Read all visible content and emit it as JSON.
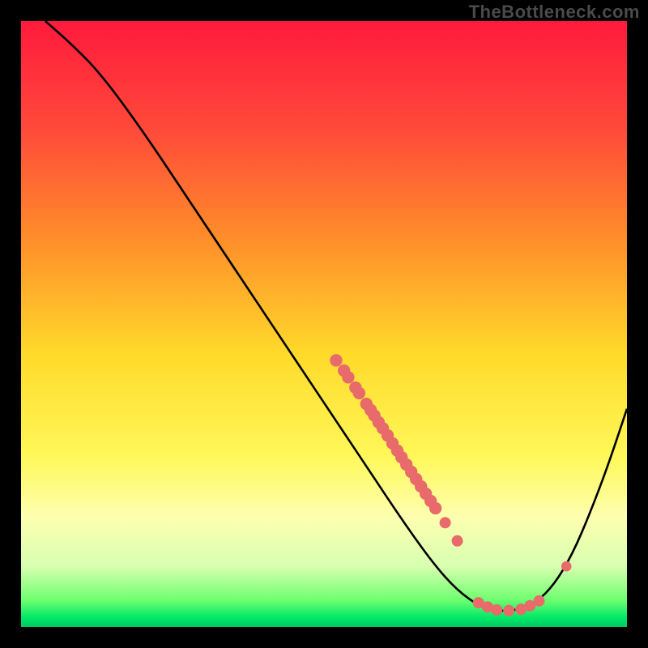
{
  "watermark": "TheBottleneck.com",
  "chart_data": {
    "type": "line",
    "title": "",
    "xlabel": "",
    "ylabel": "",
    "xlim": [
      0,
      100
    ],
    "ylim": [
      0,
      100
    ],
    "background_gradient": {
      "stops": [
        {
          "offset": 0.0,
          "color": "#ff1a3c"
        },
        {
          "offset": 0.18,
          "color": "#ff4a3a"
        },
        {
          "offset": 0.35,
          "color": "#ff8a2a"
        },
        {
          "offset": 0.55,
          "color": "#ffda2a"
        },
        {
          "offset": 0.72,
          "color": "#fff85a"
        },
        {
          "offset": 0.82,
          "color": "#fdffb0"
        },
        {
          "offset": 0.9,
          "color": "#d8ffb0"
        },
        {
          "offset": 0.955,
          "color": "#70ff70"
        },
        {
          "offset": 0.985,
          "color": "#00e868"
        },
        {
          "offset": 1.0,
          "color": "#00c95e"
        }
      ]
    },
    "curve": [
      {
        "x": 4.0,
        "y": 100.0
      },
      {
        "x": 8.0,
        "y": 96.5
      },
      {
        "x": 13.0,
        "y": 91.5
      },
      {
        "x": 20.0,
        "y": 82.0
      },
      {
        "x": 28.0,
        "y": 70.0
      },
      {
        "x": 36.0,
        "y": 58.0
      },
      {
        "x": 44.0,
        "y": 46.0
      },
      {
        "x": 52.0,
        "y": 34.0
      },
      {
        "x": 58.0,
        "y": 25.0
      },
      {
        "x": 63.0,
        "y": 17.5
      },
      {
        "x": 68.0,
        "y": 10.5
      },
      {
        "x": 72.0,
        "y": 6.0
      },
      {
        "x": 76.0,
        "y": 3.2
      },
      {
        "x": 79.0,
        "y": 2.6
      },
      {
        "x": 82.0,
        "y": 2.8
      },
      {
        "x": 85.0,
        "y": 4.0
      },
      {
        "x": 88.0,
        "y": 7.0
      },
      {
        "x": 91.0,
        "y": 12.0
      },
      {
        "x": 94.0,
        "y": 19.0
      },
      {
        "x": 97.0,
        "y": 27.0
      },
      {
        "x": 100.0,
        "y": 36.0
      }
    ],
    "dots": [
      {
        "x": 52.0,
        "y": 44.0,
        "r": 1.1
      },
      {
        "x": 53.3,
        "y": 42.3,
        "r": 1.1
      },
      {
        "x": 54.0,
        "y": 41.2,
        "r": 1.1
      },
      {
        "x": 55.2,
        "y": 39.5,
        "r": 1.1
      },
      {
        "x": 55.8,
        "y": 38.6,
        "r": 1.1
      },
      {
        "x": 57.0,
        "y": 36.8,
        "r": 1.1
      },
      {
        "x": 57.7,
        "y": 35.8,
        "r": 1.1
      },
      {
        "x": 58.3,
        "y": 34.9,
        "r": 1.1
      },
      {
        "x": 59.0,
        "y": 33.8,
        "r": 1.1
      },
      {
        "x": 59.7,
        "y": 32.8,
        "r": 1.1
      },
      {
        "x": 60.5,
        "y": 31.6,
        "r": 1.1
      },
      {
        "x": 61.3,
        "y": 30.3,
        "r": 1.1
      },
      {
        "x": 62.1,
        "y": 29.1,
        "r": 1.1
      },
      {
        "x": 62.8,
        "y": 28.0,
        "r": 1.1
      },
      {
        "x": 63.6,
        "y": 26.8,
        "r": 1.1
      },
      {
        "x": 64.4,
        "y": 25.6,
        "r": 1.1
      },
      {
        "x": 65.2,
        "y": 24.4,
        "r": 1.1
      },
      {
        "x": 66.0,
        "y": 23.2,
        "r": 1.1
      },
      {
        "x": 66.8,
        "y": 22.0,
        "r": 1.1
      },
      {
        "x": 67.6,
        "y": 20.8,
        "r": 1.1
      },
      {
        "x": 68.4,
        "y": 19.6,
        "r": 1.1
      },
      {
        "x": 70.0,
        "y": 17.2,
        "r": 1.0
      },
      {
        "x": 72.0,
        "y": 14.2,
        "r": 1.0
      },
      {
        "x": 75.5,
        "y": 4.0,
        "r": 1.0
      },
      {
        "x": 77.0,
        "y": 3.3,
        "r": 1.0
      },
      {
        "x": 78.5,
        "y": 2.8,
        "r": 1.0
      },
      {
        "x": 80.5,
        "y": 2.7,
        "r": 1.0
      },
      {
        "x": 82.5,
        "y": 2.9,
        "r": 1.0
      },
      {
        "x": 84.0,
        "y": 3.5,
        "r": 1.0
      },
      {
        "x": 85.5,
        "y": 4.3,
        "r": 1.0
      },
      {
        "x": 90.0,
        "y": 10.0,
        "r": 0.9
      }
    ],
    "colors": {
      "curve": "#000000",
      "dots": "#e86a6a",
      "frame": "#000000"
    }
  }
}
